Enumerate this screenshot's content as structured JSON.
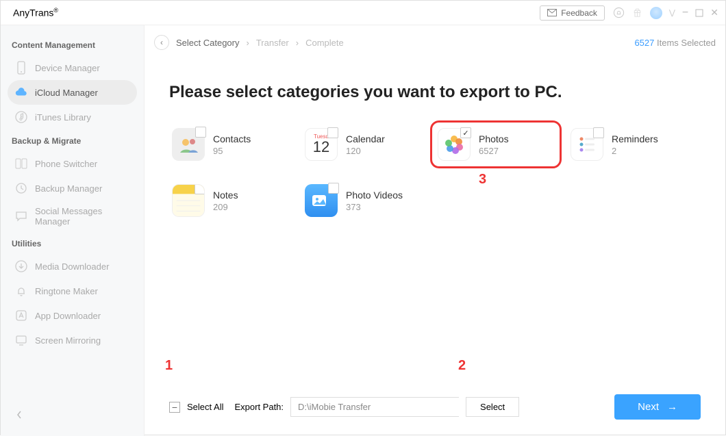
{
  "app": {
    "title": "AnyTrans",
    "trademark": "®"
  },
  "topbar": {
    "feedback": "Feedback"
  },
  "sidebar": {
    "groups": [
      {
        "label": "Content Management",
        "items": [
          {
            "icon": "device-icon",
            "label": "Device Manager",
            "active": false
          },
          {
            "icon": "cloud-icon",
            "label": "iCloud Manager",
            "active": true
          },
          {
            "icon": "music-icon",
            "label": "iTunes Library",
            "active": false
          }
        ]
      },
      {
        "label": "Backup & Migrate",
        "items": [
          {
            "icon": "switch-icon",
            "label": "Phone Switcher"
          },
          {
            "icon": "backup-icon",
            "label": "Backup Manager"
          },
          {
            "icon": "chat-icon",
            "label": "Social Messages Manager"
          }
        ]
      },
      {
        "label": "Utilities",
        "items": [
          {
            "icon": "download-icon",
            "label": "Media Downloader"
          },
          {
            "icon": "bell-icon",
            "label": "Ringtone Maker"
          },
          {
            "icon": "app-icon",
            "label": "App Downloader"
          },
          {
            "icon": "mirror-icon",
            "label": "Screen Mirroring"
          }
        ]
      }
    ]
  },
  "breadcrumb": {
    "steps": [
      "Select Category",
      "Transfer",
      "Complete"
    ],
    "selected_count": "6527",
    "selected_label": "Items Selected"
  },
  "content": {
    "heading": "Please select categories you want to export to PC.",
    "categories": [
      {
        "name": "Contacts",
        "count": "95",
        "icon": "contacts"
      },
      {
        "name": "Calendar",
        "count": "120",
        "icon": "calendar",
        "cal_label": "Tuesd",
        "cal_day": "12"
      },
      {
        "name": "Photos",
        "count": "6527",
        "icon": "photos",
        "checked": true,
        "highlight": true
      },
      {
        "name": "Reminders",
        "count": "2",
        "icon": "reminders"
      },
      {
        "name": "Notes",
        "count": "209",
        "icon": "notes"
      },
      {
        "name": "Photo Videos",
        "count": "373",
        "icon": "photovideos"
      }
    ]
  },
  "annotations": {
    "a1": "1",
    "a2": "2",
    "a3": "3"
  },
  "footer": {
    "select_all": "Select All",
    "export_path_label": "Export Path:",
    "export_path_value": "D:\\iMobie Transfer",
    "select_btn": "Select",
    "next_btn": "Next"
  }
}
